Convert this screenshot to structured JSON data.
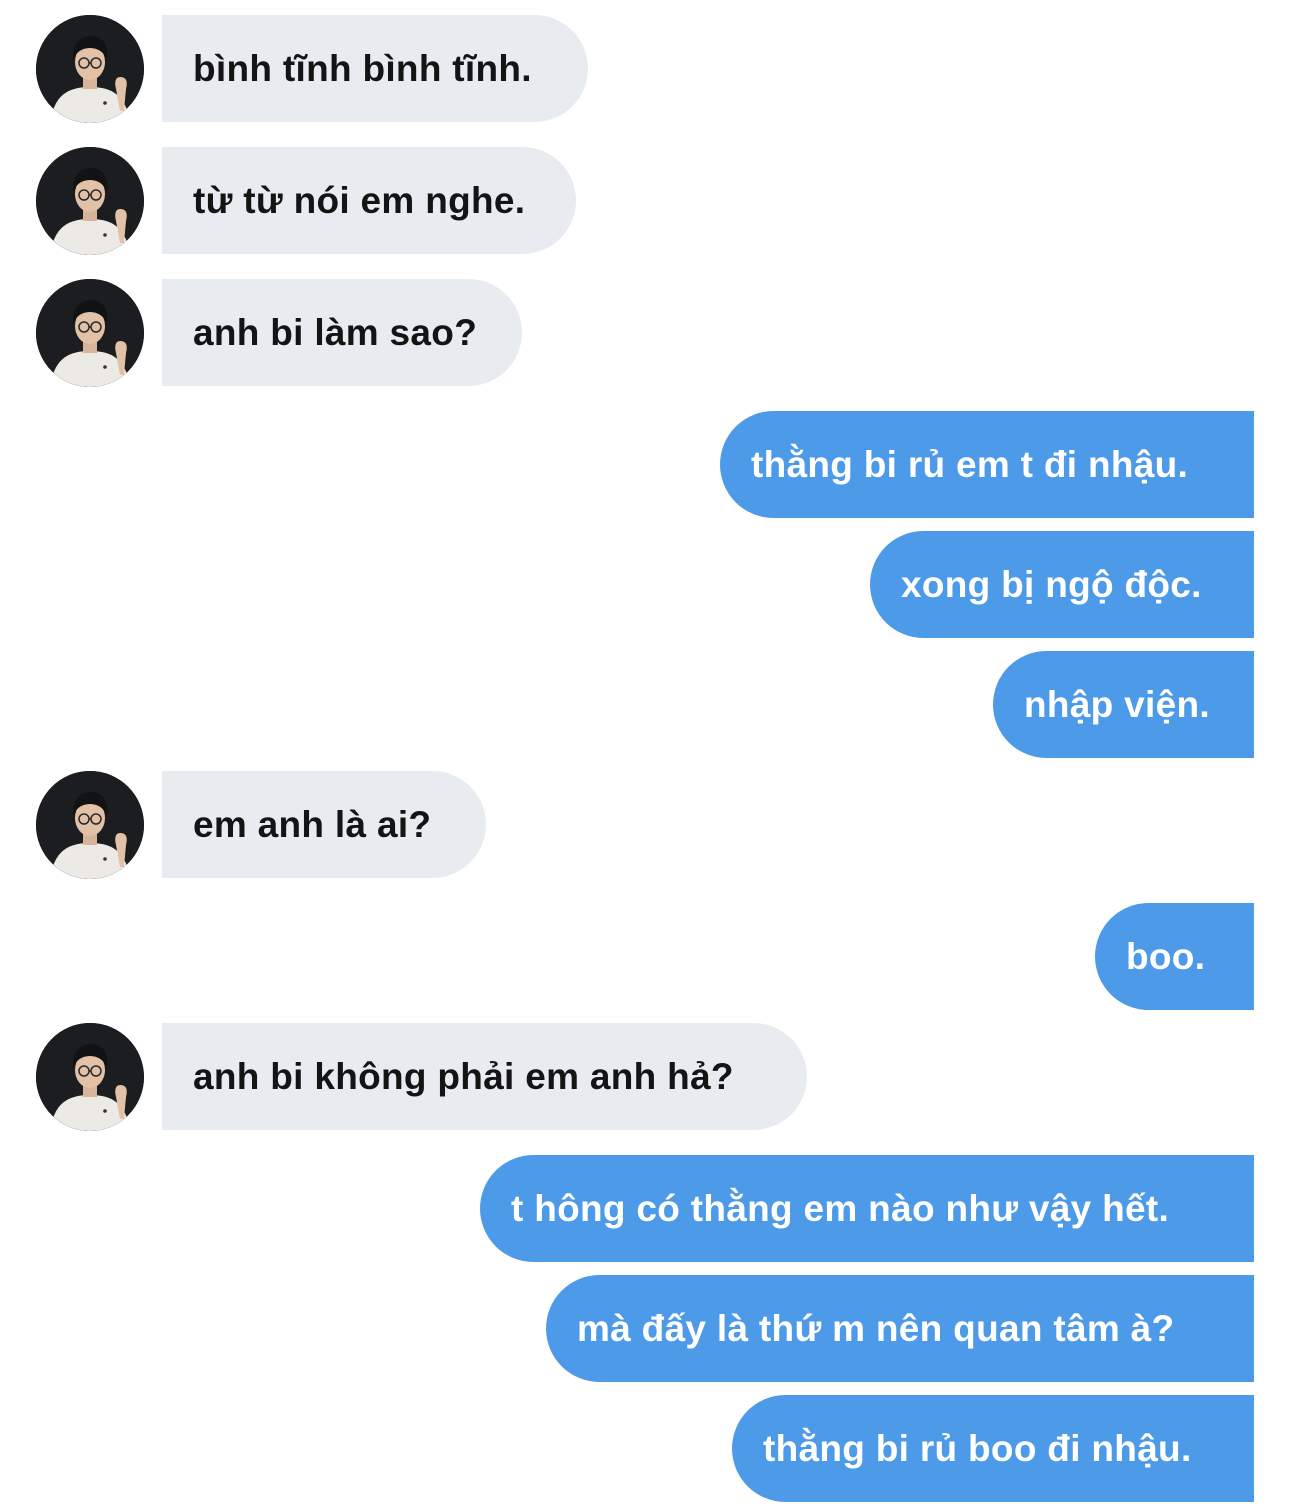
{
  "colors": {
    "incoming_bubble": "#e8ecf0",
    "outgoing_bubble": "#4d9be8",
    "incoming_text": "#141414",
    "outgoing_text": "#ffffff"
  },
  "contact": {
    "avatar_icon": "person-photo-avatar"
  },
  "messages": [
    {
      "direction": "in",
      "text": "bình tĩnh bình tĩnh."
    },
    {
      "direction": "in",
      "text": "từ từ nói em nghe."
    },
    {
      "direction": "in",
      "text": "anh bi làm sao?"
    },
    {
      "direction": "out",
      "text": "thằng bi rủ em t đi nhậu."
    },
    {
      "direction": "out",
      "text": "xong bị ngộ độc."
    },
    {
      "direction": "out",
      "text": "nhập viện."
    },
    {
      "direction": "in",
      "text": "em anh là ai?"
    },
    {
      "direction": "out",
      "text": "boo."
    },
    {
      "direction": "in",
      "text": "anh bi không phải em anh hả?"
    },
    {
      "direction": "out",
      "text": "t hông có thằng em nào như vậy hết."
    },
    {
      "direction": "out",
      "text": "mà đấy là thứ m nên quan tâm à?"
    },
    {
      "direction": "out",
      "text": "thằng bi rủ boo đi nhậu."
    }
  ]
}
